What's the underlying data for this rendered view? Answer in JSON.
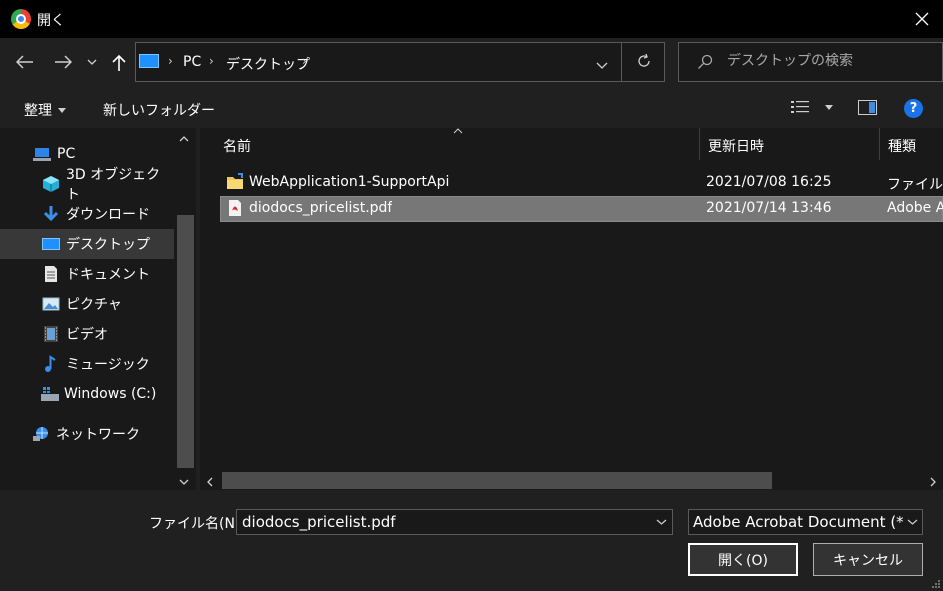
{
  "window": {
    "title": "開く",
    "close_icon": "close-icon"
  },
  "nav": {
    "back_icon": "arrow-left-icon",
    "forward_icon": "arrow-right-icon",
    "recent_icon": "chevron-down-icon",
    "up_icon": "arrow-up-icon",
    "breadcrumbs": [
      "PC",
      "デスクトップ"
    ],
    "refresh_icon": "refresh-icon"
  },
  "search": {
    "placeholder": "デスクトップの検索"
  },
  "toolbar": {
    "organize_label": "整理",
    "new_folder_label": "新しいフォルダー"
  },
  "sidebar": {
    "items": [
      {
        "label": "PC",
        "icon": "pc-icon"
      },
      {
        "label": "3D オブジェクト",
        "icon": "3d-objects-icon"
      },
      {
        "label": "ダウンロード",
        "icon": "download-icon"
      },
      {
        "label": "デスクトップ",
        "icon": "desktop-icon"
      },
      {
        "label": "ドキュメント",
        "icon": "document-icon"
      },
      {
        "label": "ピクチャ",
        "icon": "pictures-icon"
      },
      {
        "label": "ビデオ",
        "icon": "video-icon"
      },
      {
        "label": "ミュージック",
        "icon": "music-icon"
      },
      {
        "label": "Windows (C:)",
        "icon": "drive-icon"
      },
      {
        "label": "ネットワーク",
        "icon": "network-icon"
      }
    ]
  },
  "files": {
    "columns": [
      "名前",
      "更新日時",
      "種類"
    ],
    "rows": [
      {
        "name": "WebApplication1-SupportApi",
        "modified": "2021/07/08 16:25",
        "type": "ファイル フ",
        "icon": "folder-icon"
      },
      {
        "name": "diodocs_pricelist.pdf",
        "modified": "2021/07/14 13:46",
        "type": "Adobe A",
        "icon": "pdf-file-icon"
      }
    ]
  },
  "bottom": {
    "filename_label": "ファイル名(N):",
    "filename_value": "diodocs_pricelist.pdf",
    "filetype_value": "Adobe Acrobat Document (*.pc",
    "open_label": "開く(O)",
    "cancel_label": "キャンセル"
  },
  "colors": {
    "accent": "#0078d7",
    "selected_row": "#777777",
    "background": "#202020"
  }
}
